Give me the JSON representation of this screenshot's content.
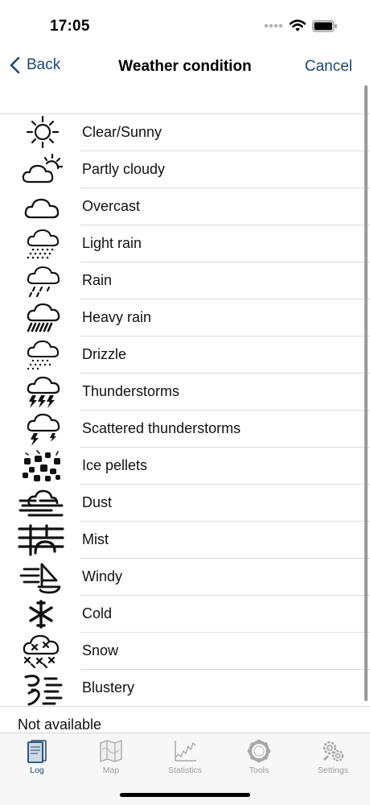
{
  "status": {
    "time": "17:05"
  },
  "nav": {
    "back_label": "Back",
    "title": "Weather condition",
    "cancel_label": "Cancel"
  },
  "conditions": [
    {
      "label": "Clear/Sunny",
      "icon": "sun-icon"
    },
    {
      "label": "Partly cloudy",
      "icon": "partly-cloudy-icon"
    },
    {
      "label": "Overcast",
      "icon": "cloud-icon"
    },
    {
      "label": "Light rain",
      "icon": "light-rain-icon"
    },
    {
      "label": "Rain",
      "icon": "rain-icon"
    },
    {
      "label": "Heavy rain",
      "icon": "heavy-rain-icon"
    },
    {
      "label": "Drizzle",
      "icon": "drizzle-icon"
    },
    {
      "label": "Thunderstorms",
      "icon": "thunderstorm-icon"
    },
    {
      "label": "Scattered thunderstorms",
      "icon": "scattered-thunderstorm-icon"
    },
    {
      "label": "Ice pellets",
      "icon": "ice-pellets-icon"
    },
    {
      "label": "Dust",
      "icon": "dust-icon"
    },
    {
      "label": "Mist",
      "icon": "mist-icon"
    },
    {
      "label": "Windy",
      "icon": "windy-icon"
    },
    {
      "label": "Cold",
      "icon": "cold-icon"
    },
    {
      "label": "Snow",
      "icon": "snow-icon"
    },
    {
      "label": "Blustery",
      "icon": "blustery-icon"
    }
  ],
  "footer": {
    "not_available_label": "Not available"
  },
  "tabs": [
    {
      "label": "Log",
      "icon": "log-book-icon",
      "active": true
    },
    {
      "label": "Map",
      "icon": "map-icon",
      "active": false
    },
    {
      "label": "Statistics",
      "icon": "statistics-chart-icon",
      "active": false
    },
    {
      "label": "Tools",
      "icon": "tools-ring-icon",
      "active": false
    },
    {
      "label": "Settings",
      "icon": "settings-gears-icon",
      "active": false
    }
  ],
  "colors": {
    "accent": "#1b4a73",
    "inactive_tab": "#9b9b9b",
    "separator": "#dcdcdc"
  }
}
